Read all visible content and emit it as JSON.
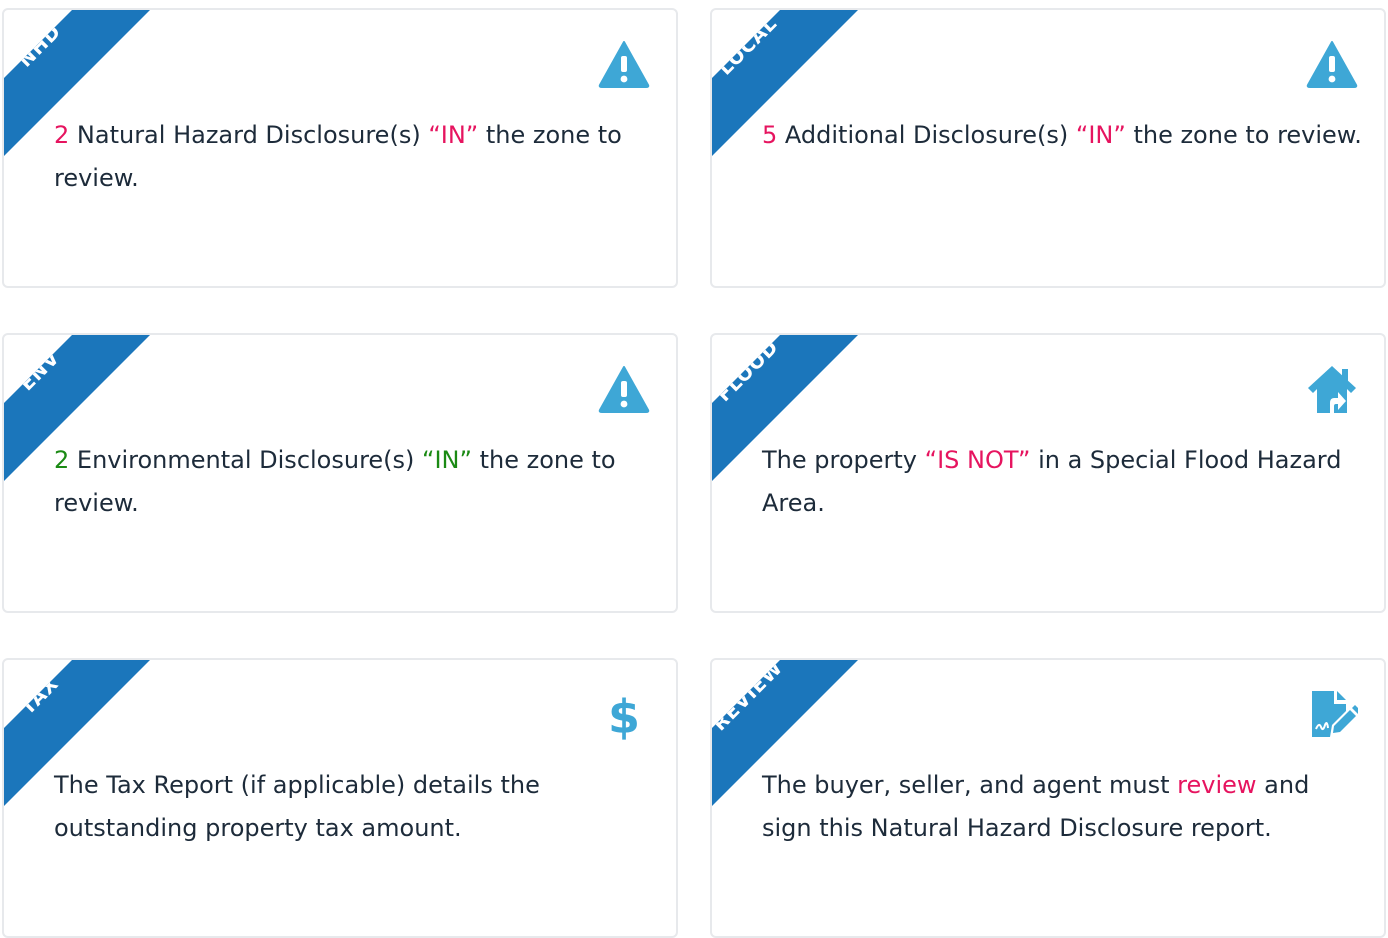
{
  "colors": {
    "ribbon": "#1b76bb",
    "icon": "#3ea7d6",
    "text": "#1d2b3a",
    "highlight_red": "#e6145f",
    "highlight_green": "#1b8a14",
    "card_border": "#e7e9ec"
  },
  "cards": [
    {
      "tag": "NHD",
      "icon": "warning-icon",
      "count": "2",
      "pre": " Natural Hazard Disclosure(s) ",
      "status": "“IN”",
      "post": " the zone to review."
    },
    {
      "tag": "LOCAL",
      "icon": "warning-icon",
      "count": "5",
      "pre": " Additional Disclosure(s) ",
      "status": "“IN”",
      "post": " the zone to review."
    },
    {
      "tag": "ENV",
      "icon": "warning-icon",
      "count": "2",
      "pre": " Environmental Disclosure(s) ",
      "status": "“IN”",
      "post": " the zone to review."
    },
    {
      "tag": "FLOOD",
      "icon": "house-icon",
      "pre": "The property ",
      "status": "“IS NOT”",
      "post": " in a Special Flood Hazard Area."
    },
    {
      "tag": "TAX",
      "icon": "dollar-icon",
      "text": "The Tax Report (if applicable) details the outstanding property tax amount."
    },
    {
      "tag": "REVIEW",
      "icon": "sign-document-icon",
      "pre": "The buyer, seller, and agent must ",
      "link": "review",
      "post": " and sign this Natural Hazard Disclosure report."
    }
  ]
}
